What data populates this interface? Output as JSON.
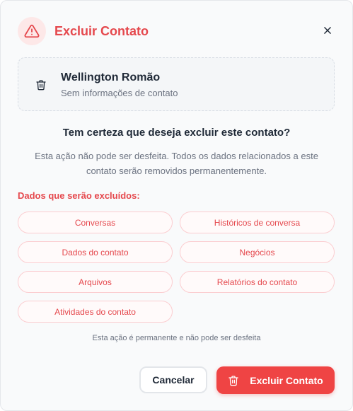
{
  "dialog": {
    "title": "Excluir Contato",
    "close_icon": "close-icon",
    "warning_icon": "alert-triangle-icon"
  },
  "contact": {
    "name": "Wellington Romão",
    "subtitle": "Sem informações de contato",
    "icon": "trash-icon"
  },
  "confirmation": {
    "question": "Tem certeza que deseja excluir este contato?",
    "description": "Esta ação não pode ser desfeita. Todos os dados relacionados a este contato serão removidos permanentemente."
  },
  "deleted_items": {
    "heading": "Dados que serão excluídos:",
    "items": [
      "Conversas",
      "Históricos de conversa",
      "Dados do contato",
      "Negócios",
      "Arquivos",
      "Relatórios do contato",
      "Atividades do contato"
    ]
  },
  "footnote": "Esta ação é permanente e não pode ser desfeita",
  "actions": {
    "cancel_label": "Cancelar",
    "delete_label": "Excluir Contato",
    "delete_icon": "trash-icon"
  },
  "colors": {
    "danger": "#ef4444",
    "danger_text": "#e5484d",
    "danger_soft_bg": "#fde8e8",
    "chip_border": "#fbcdd0"
  }
}
